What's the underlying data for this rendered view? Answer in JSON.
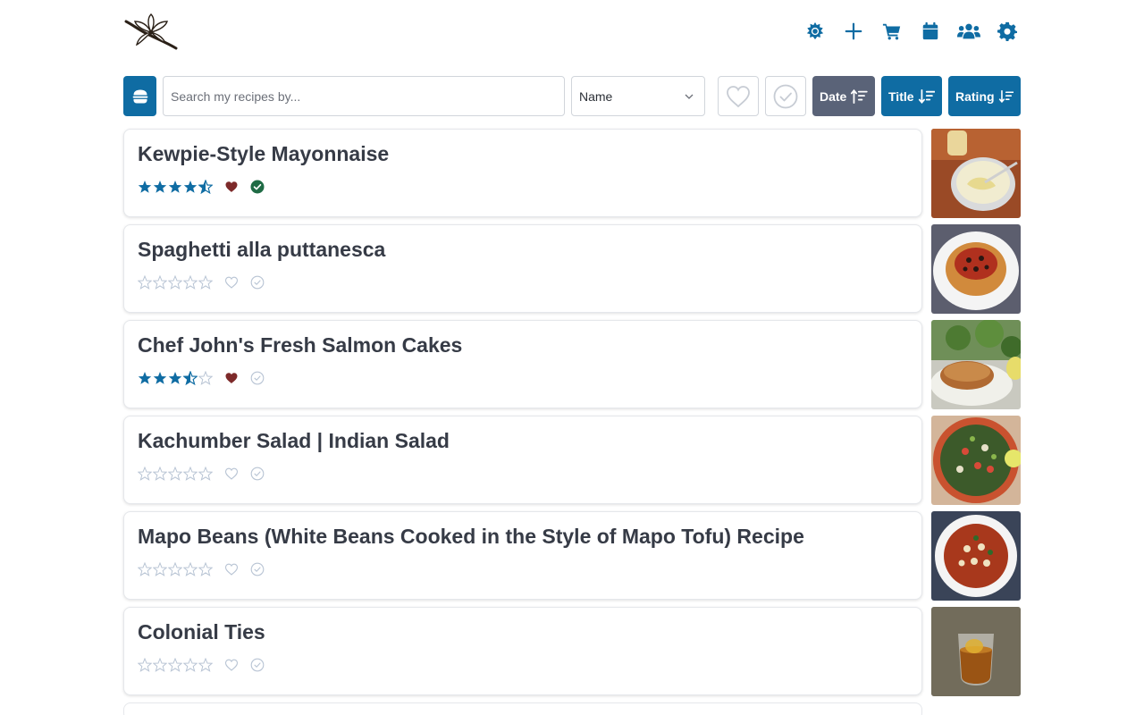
{
  "header": {
    "logo_name": "flower-logo",
    "nav": [
      {
        "name": "theme-toggle-icon"
      },
      {
        "name": "add-icon"
      },
      {
        "name": "cart-icon"
      },
      {
        "name": "calendar-icon"
      },
      {
        "name": "users-icon"
      },
      {
        "name": "settings-icon"
      }
    ]
  },
  "toolbar": {
    "search_placeholder": "Search my recipes by...",
    "search_value": "",
    "select_value": "Name",
    "sort_buttons": [
      {
        "label": "Date",
        "active": false,
        "direction": "asc"
      },
      {
        "label": "Title",
        "active": true,
        "direction": "desc"
      },
      {
        "label": "Rating",
        "active": true,
        "direction": "desc"
      }
    ]
  },
  "colors": {
    "accent": "#0f6ca3",
    "muted_button": "#5a6378",
    "favorite": "#7d2a2a",
    "done": "#1f6b45",
    "empty_star": "#b8c4d4"
  },
  "recipes": [
    {
      "title": "Kewpie-Style Mayonnaise",
      "rating": 4.5,
      "favorite": true,
      "done": true,
      "image": "mayonnaise-photo"
    },
    {
      "title": "Spaghetti alla puttanesca",
      "rating": 0,
      "favorite": false,
      "done": false,
      "image": "spaghetti-photo"
    },
    {
      "title": "Chef John's Fresh Salmon Cakes",
      "rating": 3.5,
      "favorite": true,
      "done": false,
      "image": "salmon-cake-photo"
    },
    {
      "title": "Kachumber Salad | Indian Salad",
      "rating": 0,
      "favorite": false,
      "done": false,
      "image": "salad-photo"
    },
    {
      "title": "Mapo Beans (White Beans Cooked in the Style of Mapo Tofu) Recipe",
      "rating": 0,
      "favorite": false,
      "done": false,
      "image": "mapo-beans-photo"
    },
    {
      "title": "Colonial Ties",
      "rating": 0,
      "favorite": false,
      "done": false,
      "image": "cocktail-photo"
    }
  ]
}
